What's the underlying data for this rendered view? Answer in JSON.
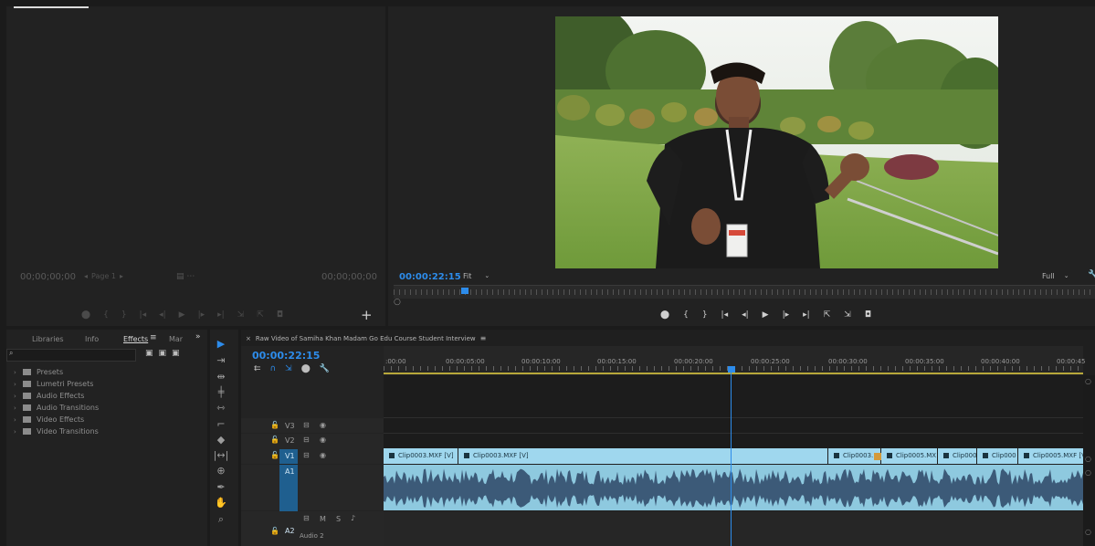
{
  "source_monitor": {
    "timecode_left": "00;00;00;00",
    "page_label": "Page 1",
    "timecode_right": "00;00;00;00"
  },
  "program_monitor": {
    "timecode": "00:00:22:15",
    "zoom": "Fit",
    "quality": "Full"
  },
  "effects_panel": {
    "tabs": [
      "Libraries",
      "Info",
      "Effects",
      "Mar"
    ],
    "active_tab": "Effects",
    "items": [
      "Presets",
      "Lumetri Presets",
      "Audio Effects",
      "Audio Transitions",
      "Video Effects",
      "Video Transitions"
    ]
  },
  "timeline": {
    "sequence_name": "Raw Video of Samiha Khan Madam Go Edu Course Student Interview",
    "timecode": "00:00:22:15",
    "ruler_labels": [
      ":00:00",
      "00:00:05:00",
      "00:00:10:00",
      "00:00:15:00",
      "00:00:20:00",
      "00:00:25:00",
      "00:00:30:00",
      "00:00:35:00",
      "00:00:40:00",
      "00:00:45"
    ],
    "tracks": {
      "v3": "V3",
      "v2": "V2",
      "v1": "V1",
      "a1": "A1",
      "a2": "A2",
      "a2_name": "Audio 2",
      "m": "M",
      "s": "S"
    },
    "video_clips": [
      "Clip0003.MXF [V]",
      "Clip0003.MXF [V]",
      "Clip0003.",
      "Clip0005.MX",
      "Clip000",
      "Clip000",
      "Clip0005.MXF [V]"
    ]
  },
  "colors": {
    "accent": "#2d8ceb",
    "video_clip": "#9fd7ee",
    "audio_clip": "#8ec9df",
    "waveform": "#3c5a78",
    "panel_bg": "#232323"
  }
}
